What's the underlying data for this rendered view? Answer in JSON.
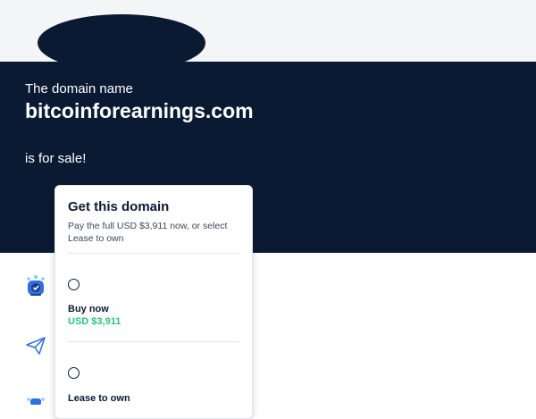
{
  "hero": {
    "pre_text": "The domain name",
    "domain": "bitcoinforearnings.com",
    "post_text": "is for sale!"
  },
  "card": {
    "title": "Get this domain",
    "description": "Pay the full USD $3,911 now, or select Lease to own",
    "options": [
      {
        "label": "Buy now",
        "price": "USD $3,911"
      },
      {
        "label": "Lease to own"
      }
    ]
  },
  "colors": {
    "navy": "#0b1a33",
    "accent_green": "#2ec27e",
    "icon_blue": "#2f6fde"
  },
  "icons": [
    "logo-placeholder",
    "shield-check-icon",
    "paper-plane-icon",
    "badge-icon"
  ]
}
